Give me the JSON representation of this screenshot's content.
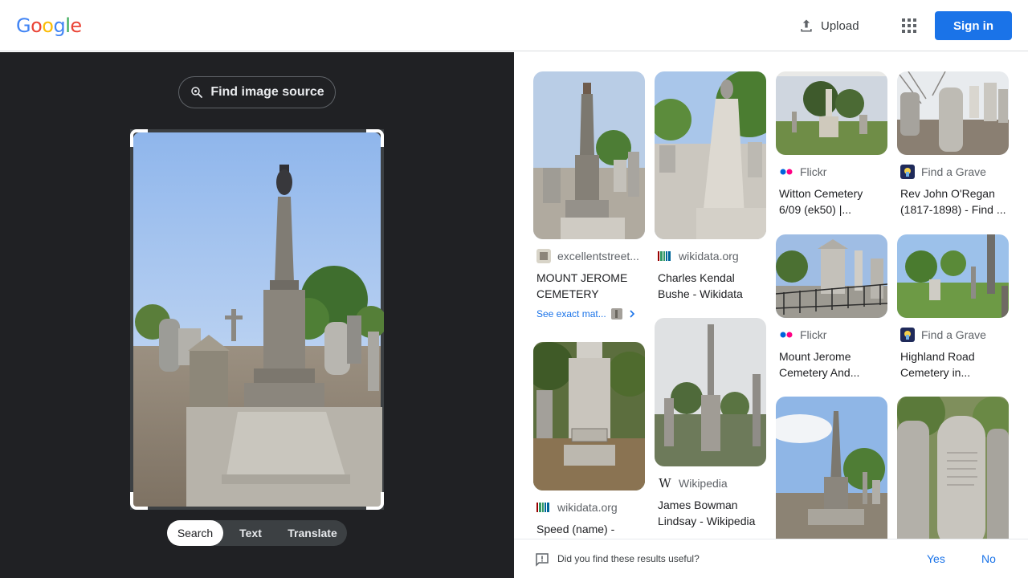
{
  "header": {
    "logo": [
      "G",
      "o",
      "o",
      "g",
      "l",
      "e"
    ],
    "logo_colors": [
      "#4285F4",
      "#EA4335",
      "#FBBC05",
      "#4285F4",
      "#34A853",
      "#EA4335"
    ],
    "upload_label": "Upload",
    "signin_label": "Sign in"
  },
  "left": {
    "find_source_label": "Find image source",
    "tabs": [
      "Search",
      "Text",
      "Translate"
    ]
  },
  "results": {
    "items": [
      {
        "source": "excellentstreet...",
        "title": "MOUNT JEROME CEMETERY",
        "favicon": "excellentstreet-favicon"
      },
      {
        "source": "wikidata.org",
        "title": "Charles Kendal Bushe - Wikidata",
        "favicon": "wikidata-favicon"
      },
      {
        "source": "Flickr",
        "title": "Witton Cemetery 6/09 (ek50) |...",
        "favicon": "flickr-favicon"
      },
      {
        "source": "Find a Grave",
        "title": "Rev John O'Regan (1817-1898) - Find ...",
        "favicon": "findagrave-favicon"
      },
      {
        "source": "Flickr",
        "title": "Mount Jerome Cemetery And...",
        "favicon": "flickr-favicon"
      },
      {
        "source": "Find a Grave",
        "title": "Highland Road Cemetery in...",
        "favicon": "findagrave-favicon"
      },
      {
        "source": "wikidata.org",
        "title": "Speed (name) -",
        "favicon": "wikidata-favicon"
      },
      {
        "source": "Wikipedia",
        "title": "James Bowman Lindsay - Wikipedia",
        "favicon": "wikipedia-favicon"
      }
    ],
    "exact_matches_label": "See exact mat..."
  },
  "feedback": {
    "question": "Did you find these results useful?",
    "yes": "Yes",
    "no": "No"
  }
}
